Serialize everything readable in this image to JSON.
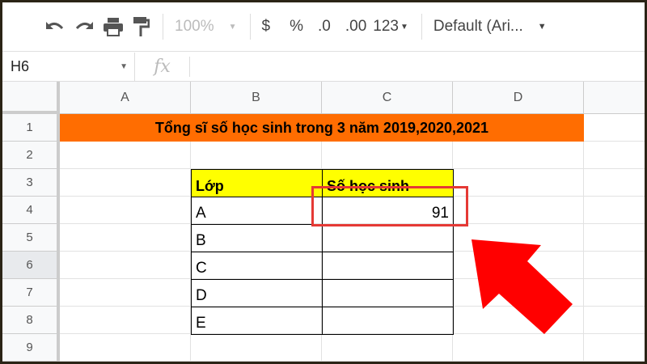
{
  "toolbar": {
    "zoom": "100%",
    "currency": "$",
    "percent": "%",
    "decrease_decimal": ".0",
    "increase_decimal": ".00",
    "format": "123",
    "font": "Default (Ari..."
  },
  "formula_bar": {
    "cell_ref": "H6",
    "fx": "fx",
    "value": ""
  },
  "columns": [
    "A",
    "B",
    "C",
    "D"
  ],
  "rows": [
    "1",
    "2",
    "3",
    "4",
    "5",
    "6",
    "7",
    "8",
    "9"
  ],
  "selected_row": "6",
  "sheet": {
    "title": "Tổng sĩ số học sinh trong 3 năm 2019,2020,2021",
    "header_class": "Lớp",
    "header_count": "Số học sinh",
    "classes": [
      "A",
      "B",
      "C",
      "D",
      "E"
    ],
    "counts": [
      "91",
      "",
      "",
      "",
      ""
    ]
  },
  "colors": {
    "title_bg": "#ff6d01",
    "header_bg": "#ffff00",
    "highlight": "#e53935",
    "arrow": "#ff0000"
  }
}
